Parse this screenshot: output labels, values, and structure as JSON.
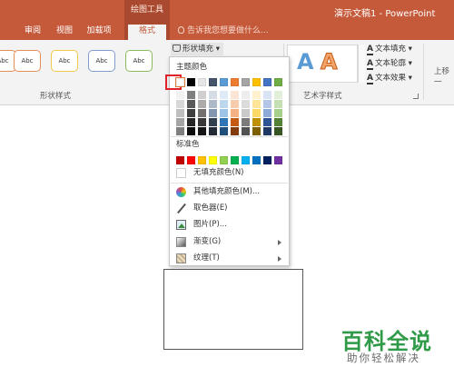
{
  "titlebar": {
    "context_group": "绘图工具",
    "doc_title": "演示文稿1 - PowerPoint",
    "tabs": [
      "审阅",
      "视图",
      "加载项",
      "格式"
    ],
    "tell_me": "告诉我您想要做什么..."
  },
  "ribbon": {
    "style_buttons": [
      "Abc",
      "Abc",
      "Abc",
      "Abc",
      "Abc"
    ],
    "shape_fill_label": "形状填充",
    "shape_styles_label": "形状样式",
    "wordart_styles_label": "艺术字样式",
    "text_fill": "文本填充",
    "text_outline": "文本轮廓",
    "text_effects": "文本效果",
    "bring_forward": "上移一",
    "wordart_letters": [
      "A",
      "A"
    ]
  },
  "dropdown": {
    "theme_colors_label": "主题颜色",
    "standard_colors_label": "标准色",
    "theme_top": [
      "#ffffff",
      "#000000",
      "#e7e6e6",
      "#44546a",
      "#5b9bd5",
      "#ed7d31",
      "#a5a5a5",
      "#ffc000",
      "#4472c4",
      "#70ad47"
    ],
    "theme_shades": [
      [
        "#f2f2f2",
        "#7f7f7f",
        "#d0cece",
        "#d6dce4",
        "#deebf6",
        "#fbe5d5",
        "#ededed",
        "#fff2cc",
        "#dae3f3",
        "#e2efd9"
      ],
      [
        "#d8d8d8",
        "#595959",
        "#aeaaaa",
        "#adb9ca",
        "#bdd7ee",
        "#f7cbac",
        "#dbdbdb",
        "#fee599",
        "#b4c6e7",
        "#c5e0b3"
      ],
      [
        "#bfbfbf",
        "#3f3f3f",
        "#757070",
        "#8496b0",
        "#9dc3e6",
        "#f4b183",
        "#c9c9c9",
        "#ffd965",
        "#8eaadb",
        "#a8d08d"
      ],
      [
        "#a5a5a5",
        "#262626",
        "#3a3838",
        "#323f4f",
        "#2e75b5",
        "#c55a11",
        "#7b7b7b",
        "#bf9000",
        "#2f5496",
        "#538135"
      ],
      [
        "#7f7f7f",
        "#0c0c0c",
        "#171616",
        "#222a35",
        "#1e4e79",
        "#833c0b",
        "#525252",
        "#7f6000",
        "#1f3864",
        "#375623"
      ]
    ],
    "standard": [
      "#c00000",
      "#ff0000",
      "#ffc000",
      "#ffff00",
      "#92d050",
      "#00b050",
      "#00b0f0",
      "#0070c0",
      "#002060",
      "#7030a0"
    ],
    "items": [
      {
        "label": "无填充颜色(N)",
        "icon": "no-fill-icon"
      },
      {
        "label": "其他填充颜色(M)...",
        "icon": "color-wheel-icon"
      },
      {
        "label": "取色器(E)",
        "icon": "eyedropper-icon"
      },
      {
        "label": "图片(P)...",
        "icon": "picture-icon"
      },
      {
        "label": "渐变(G)",
        "icon": "gradient-icon"
      },
      {
        "label": "纹理(T)",
        "icon": "texture-icon"
      }
    ]
  },
  "watermark": {
    "main": "百科全说",
    "sub": "助你轻松解决"
  }
}
